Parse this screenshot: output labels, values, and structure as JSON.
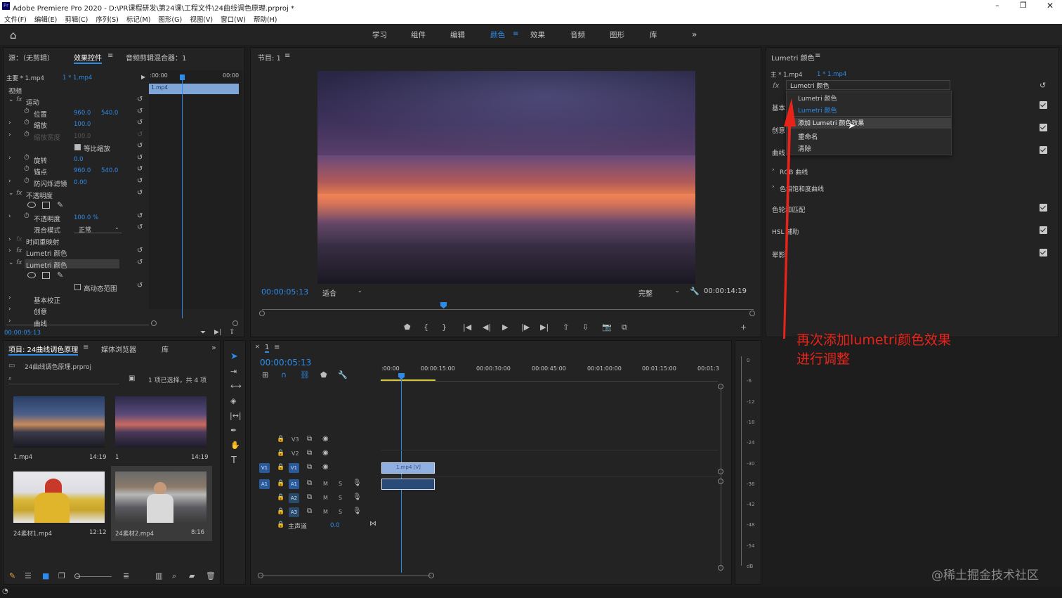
{
  "title_bar": {
    "app_title": "Adobe Premiere Pro 2020 - D:\\PR课程研发\\第24课\\工程文件\\24曲线调色原理.prproj *"
  },
  "menu": [
    "文件(F)",
    "编辑(E)",
    "剪辑(C)",
    "序列(S)",
    "标记(M)",
    "图形(G)",
    "视图(V)",
    "窗口(W)",
    "帮助(H)"
  ],
  "workspaces": [
    "学习",
    "组件",
    "编辑",
    "颜色",
    "效果",
    "音频",
    "图形",
    "库"
  ],
  "workspace_active": "颜色",
  "effect_controls": {
    "tabs": [
      "源：（无剪辑）",
      "效果控件",
      "音频剪辑混合器：1"
    ],
    "master_label": "主要 * 1.mp4",
    "clip_label": "1 * 1.mp4",
    "ruler_start": ":00:00",
    "ruler_end": "00:00",
    "clip_name": "1.mp4",
    "section_video": "视频",
    "motion": "运动",
    "position": "位置",
    "pos_x": "960.0",
    "pos_y": "540.0",
    "scale": "缩放",
    "scale_val": "100.0",
    "scale_width": "缩放宽度",
    "scale_width_val": "100.0",
    "uniform_scale": "等比缩放",
    "rotation": "旋转",
    "rotation_val": "0.0",
    "anchor": "锚点",
    "anchor_x": "960.0",
    "anchor_y": "540.0",
    "flicker": "防闪烁滤镜",
    "flicker_val": "0.00",
    "opacity_group": "不透明度",
    "opacity": "不透明度",
    "opacity_val": "100.0 %",
    "blend_mode": "混合模式",
    "blend_val": "正常",
    "time_remap": "时间重映射",
    "lumetri1": "Lumetri 颜色",
    "lumetri2": "Lumetri 颜色",
    "hdr": "高动态范围",
    "basic": "基本校正",
    "creative": "创意",
    "curves": "曲线",
    "timecode": "00:00:05:13"
  },
  "program": {
    "title": "节目: 1",
    "timecode": "00:00:05:13",
    "fit": "适合",
    "quality": "完整",
    "duration": "00:00:14:19"
  },
  "lumetri_panel": {
    "title": "Lumetri 颜色",
    "master": "主 * 1.mp4",
    "clip": "1 * 1.mp4",
    "effect_select": "Lumetri 颜色",
    "sections": [
      "基本",
      "创意",
      "曲线"
    ],
    "rgb_curves": "RGB 曲线",
    "hue_sat": "色相饱和度曲线",
    "color_wheels": "色轮和匹配",
    "hsl": "HSL 辅助",
    "vignette": "晕影",
    "dropdown": {
      "opt1": "Lumetri 颜色",
      "opt2": "Lumetri 颜色",
      "add": "添加 Lumetri 颜色效果",
      "rename": "重命名",
      "clear": "清除"
    }
  },
  "annotation": {
    "line1": "再次添加lumetri颜色效果",
    "line2": "进行调整",
    "color": "#e8241a"
  },
  "project": {
    "tabs": [
      "项目: 24曲线调色原理",
      "媒体浏览器",
      "库"
    ],
    "file": "24曲线调色原理.prproj",
    "status": "1 项已选择，共 4 项",
    "items": [
      {
        "name": "1.mp4",
        "dur": "14:19"
      },
      {
        "name": "1",
        "dur": "14:19"
      },
      {
        "name": "24素材1.mp4",
        "dur": "12:12"
      },
      {
        "name": "24素材2.mp4",
        "dur": "8:16"
      }
    ]
  },
  "timeline": {
    "tab": "1",
    "timecode": "00:00:05:13",
    "ruler": [
      ":00:00",
      "00:00:15:00",
      "00:00:30:00",
      "00:00:45:00",
      "00:01:00:00",
      "00:01:15:00",
      "00:01:3"
    ],
    "video_tracks": [
      "V3",
      "V2",
      "V1"
    ],
    "audio_tracks": [
      "A1",
      "A2",
      "A3"
    ],
    "master": "主声道",
    "master_val": "0.0",
    "clip_v": "1.mp4 [V]",
    "src_v": "V1",
    "src_a": "A1",
    "m": "M",
    "s": "S"
  },
  "meter": [
    "0",
    "-6",
    "-12",
    "-18",
    "-24",
    "-30",
    "-36",
    "-42",
    "-48",
    "-54",
    "dB"
  ],
  "watermark": "@稀土掘金技术社区"
}
